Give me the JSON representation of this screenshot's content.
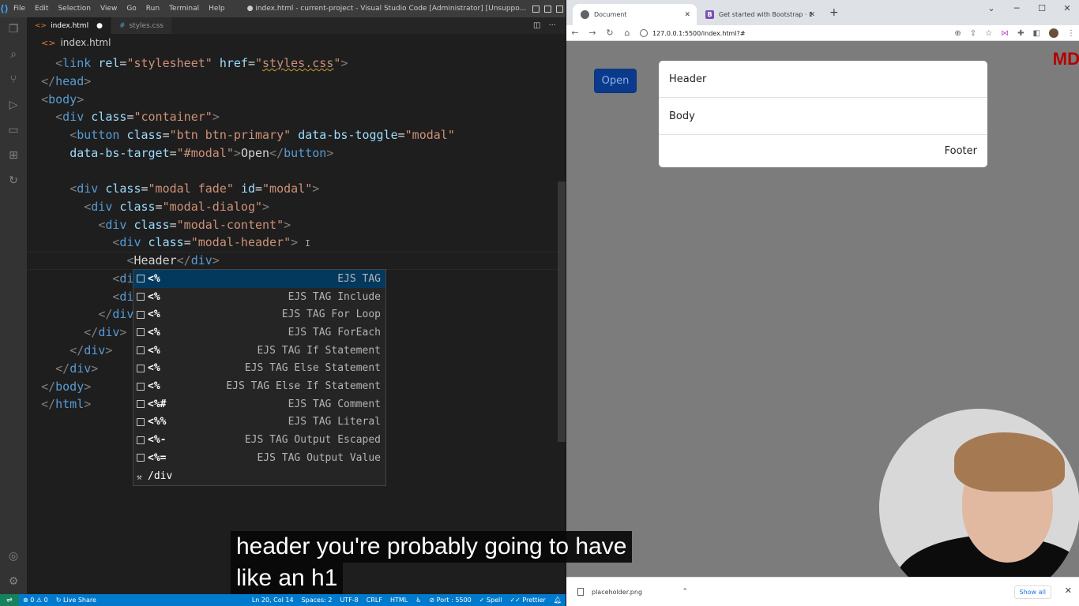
{
  "vscode": {
    "menu": [
      "File",
      "Edit",
      "Selection",
      "View",
      "Go",
      "Run",
      "Terminal",
      "Help"
    ],
    "window_title": "● index.html - current-project - Visual Studio Code [Administrator] [Unsuppo...",
    "tabs": [
      {
        "label": "index.html",
        "modified": "●"
      },
      {
        "label": "styles.css"
      }
    ],
    "breadcrumb": "index.html",
    "suggestions": [
      {
        "label": "<%",
        "detail": "EJS TAG"
      },
      {
        "label": "<%",
        "detail": "EJS TAG Include"
      },
      {
        "label": "<%",
        "detail": "EJS TAG For Loop"
      },
      {
        "label": "<%",
        "detail": "EJS TAG ForEach"
      },
      {
        "label": "<%",
        "detail": "EJS TAG If Statement"
      },
      {
        "label": "<%",
        "detail": "EJS TAG Else Statement"
      },
      {
        "label": "<%",
        "detail": "EJS TAG Else If Statement"
      },
      {
        "label": "<%#",
        "detail": "EJS TAG Comment"
      },
      {
        "label": "<%%",
        "detail": "EJS TAG Literal"
      },
      {
        "label": "<%-",
        "detail": "EJS TAG Output Escaped"
      },
      {
        "label": "<%=",
        "detail": "EJS TAG Output Value"
      },
      {
        "label": "/div",
        "detail": ""
      }
    ],
    "status": {
      "problems": "⊗ 0 ⚠ 0",
      "live_share": "Live Share",
      "position": "Ln 20, Col 14",
      "spaces": "Spaces: 2",
      "encoding": "UTF-8",
      "eol": "CRLF",
      "language": "HTML",
      "port": "Port : 5500",
      "spell": "Spell",
      "prettier": "Prettier"
    }
  },
  "browser": {
    "tabs": [
      {
        "title": "Document"
      },
      {
        "title": "Get started with Bootstrap · Boo"
      }
    ],
    "url": "127.0.0.1:5500/index.html?#",
    "page": {
      "open_button": "Open",
      "modal_header": "Header",
      "modal_body": "Body",
      "modal_footer": "Footer",
      "logo": "MD"
    },
    "downloads": {
      "file": "placeholder.png",
      "show_all": "Show all"
    }
  },
  "subtitles": {
    "line1": "header you're probably going to have",
    "line2": "like an h1"
  }
}
